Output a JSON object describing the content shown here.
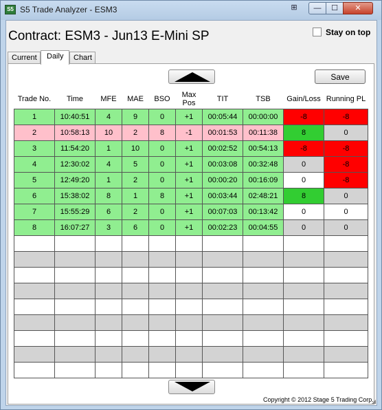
{
  "window": {
    "app_icon_text": "S5",
    "title": "S5 Trade Analyzer - ESM3",
    "buttons": {
      "minimize": "—",
      "maximize": "☐",
      "close": "✕",
      "layout": "⊞"
    }
  },
  "header": {
    "contract_label": "Contract: ESM3 - Jun13 E-Mini SP",
    "stay_on_top_label": "Stay on top",
    "stay_on_top_checked": false
  },
  "tabs": [
    {
      "label": "Current",
      "active": false
    },
    {
      "label": "Daily",
      "active": true
    },
    {
      "label": "Chart",
      "active": false
    }
  ],
  "toolbar": {
    "save_label": "Save"
  },
  "table": {
    "columns": [
      "Trade No.",
      "Time",
      "MFE",
      "MAE",
      "BSO",
      "Max Pos",
      "TIT",
      "TSB",
      "Gain/Loss",
      "Running PL"
    ],
    "rows": [
      {
        "cells": [
          "1",
          "10:40:51",
          "4",
          "9",
          "0",
          "+1",
          "00:05:44",
          "00:00:00",
          "-8",
          "-8"
        ],
        "row_color": "#90ee90",
        "gl_color": "#ff0000",
        "pl_color": "#ff0000"
      },
      {
        "cells": [
          "2",
          "10:58:13",
          "10",
          "2",
          "8",
          "-1",
          "00:01:53",
          "00:11:38",
          "8",
          "0"
        ],
        "row_color": "#ffc0cb",
        "gl_color": "#32cd32",
        "pl_color": "#d3d3d3"
      },
      {
        "cells": [
          "3",
          "11:54:20",
          "1",
          "10",
          "0",
          "+1",
          "00:02:52",
          "00:54:13",
          "-8",
          "-8"
        ],
        "row_color": "#90ee90",
        "gl_color": "#ff0000",
        "pl_color": "#ff0000"
      },
      {
        "cells": [
          "4",
          "12:30:02",
          "4",
          "5",
          "0",
          "+1",
          "00:03:08",
          "00:32:48",
          "0",
          "-8"
        ],
        "row_color": "#90ee90",
        "gl_color": "#d3d3d3",
        "pl_color": "#ff0000"
      },
      {
        "cells": [
          "5",
          "12:49:20",
          "1",
          "2",
          "0",
          "+1",
          "00:00:20",
          "00:16:09",
          "0",
          "-8"
        ],
        "row_color": "#90ee90",
        "gl_color": "#ffffff",
        "pl_color": "#ff0000"
      },
      {
        "cells": [
          "6",
          "15:38:02",
          "8",
          "1",
          "8",
          "+1",
          "00:03:44",
          "02:48:21",
          "8",
          "0"
        ],
        "row_color": "#90ee90",
        "gl_color": "#32cd32",
        "pl_color": "#d3d3d3"
      },
      {
        "cells": [
          "7",
          "15:55:29",
          "6",
          "2",
          "0",
          "+1",
          "00:07:03",
          "00:13:42",
          "0",
          "0"
        ],
        "row_color": "#90ee90",
        "gl_color": "#ffffff",
        "pl_color": "#ffffff"
      },
      {
        "cells": [
          "8",
          "16:07:27",
          "3",
          "6",
          "0",
          "+1",
          "00:02:23",
          "00:04:55",
          "0",
          "0"
        ],
        "row_color": "#90ee90",
        "gl_color": "#d3d3d3",
        "pl_color": "#d3d3d3"
      }
    ],
    "empty_row_count": 9
  },
  "footer": {
    "copyright": "Copyright © 2012 Stage 5 Trading Corp."
  },
  "icons": {
    "scroll_up": "up-arrow-icon",
    "scroll_down": "down-arrow-icon",
    "resize_grip": "resize-grip-icon"
  }
}
